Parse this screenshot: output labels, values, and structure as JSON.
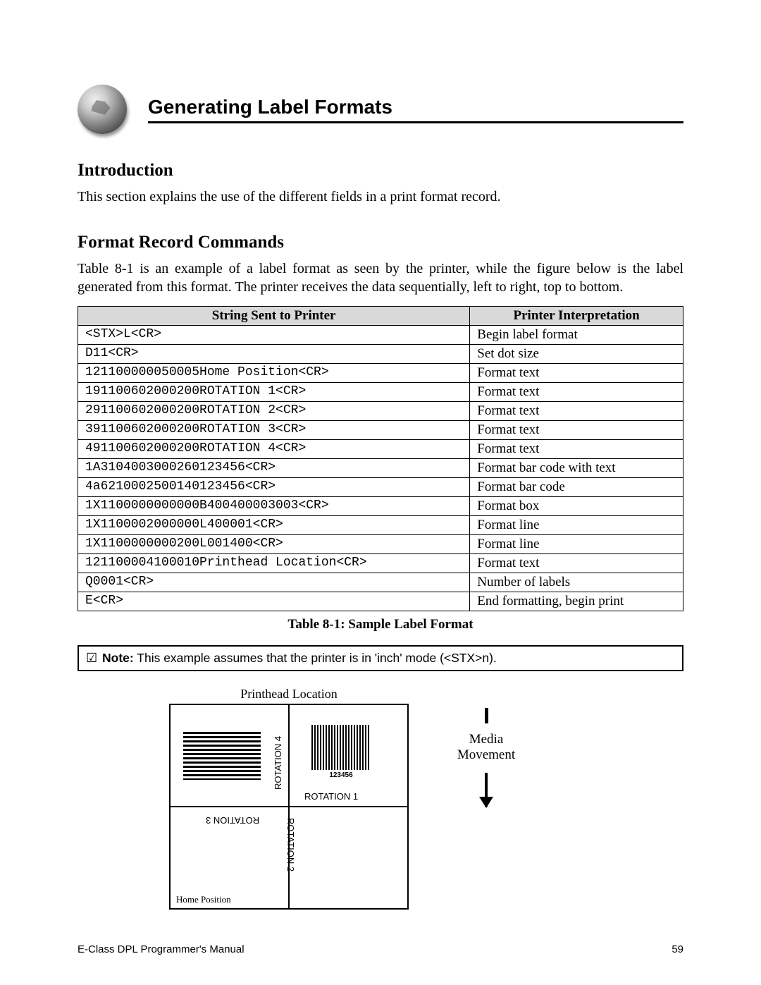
{
  "header": {
    "title": "Generating Label Formats"
  },
  "intro": {
    "heading": "Introduction",
    "text": "This section explains the use of the different fields in a print format record."
  },
  "frc": {
    "heading": "Format Record Commands",
    "text": "Table 8-1 is an example of a label format as seen by the printer, while the figure below is the label generated from this format. The printer receives the data sequentially, left to right, top to bottom."
  },
  "table": {
    "col1": "String Sent to Printer",
    "col2": "Printer Interpretation",
    "rows": [
      {
        "s": "<STX>L<CR>",
        "p": "Begin label format"
      },
      {
        "s": "D11<CR>",
        "p": "Set dot size"
      },
      {
        "s": "121100000050005Home Position<CR>",
        "p": "Format text"
      },
      {
        "s": "191100602000200ROTATION 1<CR>",
        "p": "Format text"
      },
      {
        "s": "291100602000200ROTATION 2<CR>",
        "p": "Format text"
      },
      {
        "s": "391100602000200ROTATION 3<CR>",
        "p": "Format text"
      },
      {
        "s": "491100602000200ROTATION 4<CR>",
        "p": "Format text"
      },
      {
        "s": "1A3104003000260123456<CR>",
        "p": "Format bar code with text"
      },
      {
        "s": "4a6210002500140123456<CR>",
        "p": "Format bar code"
      },
      {
        "s": "1X1100000000000B400400003003<CR>",
        "p": "Format box"
      },
      {
        "s": "1X1100002000000L400001<CR>",
        "p": "Format line"
      },
      {
        "s": "1X1100000000200L001400<CR>",
        "p": "Format line"
      },
      {
        "s": "121100004100010Printhead Location<CR>",
        "p": "Format text"
      },
      {
        "s": "Q0001<CR>",
        "p": "Number of labels"
      },
      {
        "s": "E<CR>",
        "p": "End formatting, begin print"
      }
    ],
    "caption": "Table 8-1: Sample Label Format"
  },
  "note": {
    "label": "Note:",
    "text": " This example assumes that the printer is in 'inch' mode (<STX>n)."
  },
  "figure": {
    "printhead": "Printhead Location",
    "rot1": "ROTATION 1",
    "rot2": "ROTATION 2",
    "rot3": "ROTATION 3",
    "rot4": "ROTATION 4",
    "barcode_number": "123456",
    "home": "Home Position",
    "media1": "Media",
    "media2": "Movement"
  },
  "footer": {
    "left": "E-Class DPL Programmer's Manual",
    "right": "59"
  }
}
